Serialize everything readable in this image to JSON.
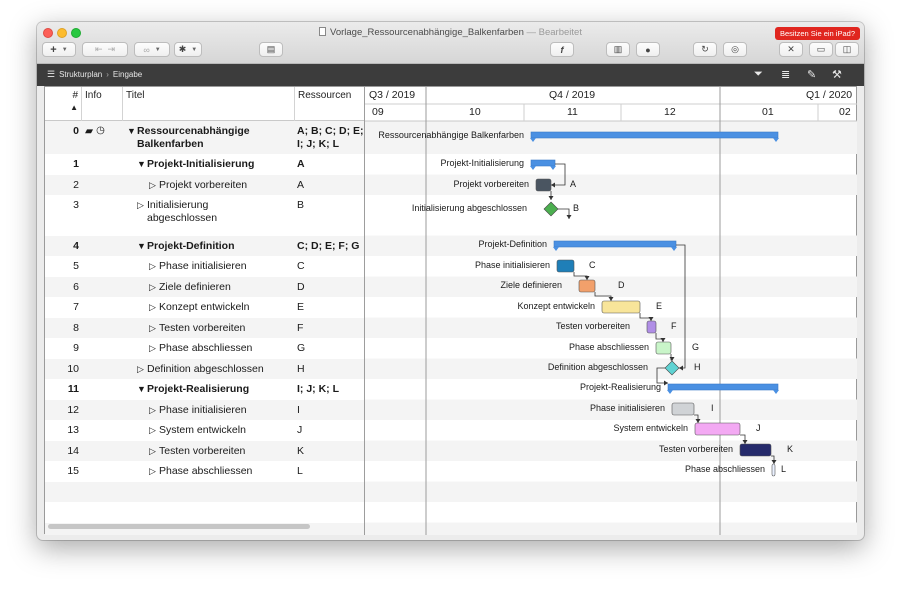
{
  "window": {
    "title": "Vorlage_Ressourcenabhängige_Balkenfarben",
    "edited_suffix": "— Bearbeitet",
    "ipad_badge": "Besitzen Sie ein iPad?"
  },
  "toolbar": {
    "add_label": "+",
    "function_label": "f"
  },
  "breadcrumb": {
    "root": "Strukturplan",
    "child": "Eingabe"
  },
  "table": {
    "headers": {
      "num": "#",
      "info": "Info",
      "title": "Titel",
      "resources": "Ressourcen"
    },
    "rows": [
      {
        "num": "0",
        "title_line1": "Ressourcenabhängige",
        "title_line2": "Balkenfarben",
        "res_line1": "A; B; C; D; E;",
        "res_line2": "I; J; K; L",
        "bold": true,
        "level": 0,
        "expanded": true
      },
      {
        "num": "1",
        "title_line1": "Projekt-Initialisierung",
        "title_line2": "",
        "res_line1": "A",
        "res_line2": "",
        "bold": true,
        "level": 1,
        "expanded": true
      },
      {
        "num": "2",
        "title_line1": "Projekt vorbereiten",
        "title_line2": "",
        "res_line1": "A",
        "res_line2": "",
        "bold": false,
        "level": 2,
        "expanded": false
      },
      {
        "num": "3",
        "title_line1": "Initialisierung",
        "title_line2": "abgeschlossen",
        "res_line1": "B",
        "res_line2": "",
        "bold": false,
        "level": 1,
        "expanded": false
      },
      {
        "num": "4",
        "title_line1": "Projekt-Definition",
        "title_line2": "",
        "res_line1": "C; D; E; F; G",
        "res_line2": "",
        "bold": true,
        "level": 1,
        "expanded": true
      },
      {
        "num": "5",
        "title_line1": "Phase initialisieren",
        "title_line2": "",
        "res_line1": "C",
        "res_line2": "",
        "bold": false,
        "level": 2,
        "expanded": false
      },
      {
        "num": "6",
        "title_line1": "Ziele definieren",
        "title_line2": "",
        "res_line1": "D",
        "res_line2": "",
        "bold": false,
        "level": 2,
        "expanded": false
      },
      {
        "num": "7",
        "title_line1": "Konzept entwickeln",
        "title_line2": "",
        "res_line1": "E",
        "res_line2": "",
        "bold": false,
        "level": 2,
        "expanded": false
      },
      {
        "num": "8",
        "title_line1": "Testen vorbereiten",
        "title_line2": "",
        "res_line1": "F",
        "res_line2": "",
        "bold": false,
        "level": 2,
        "expanded": false
      },
      {
        "num": "9",
        "title_line1": "Phase abschliessen",
        "title_line2": "",
        "res_line1": "G",
        "res_line2": "",
        "bold": false,
        "level": 2,
        "expanded": false
      },
      {
        "num": "10",
        "title_line1": "Definition abgeschlossen",
        "title_line2": "",
        "res_line1": "H",
        "res_line2": "",
        "bold": false,
        "level": 1,
        "expanded": false
      },
      {
        "num": "11",
        "title_line1": "Projekt-Realisierung",
        "title_line2": "",
        "res_line1": "I; J; K; L",
        "res_line2": "",
        "bold": true,
        "level": 1,
        "expanded": true
      },
      {
        "num": "12",
        "title_line1": "Phase initialisieren",
        "title_line2": "",
        "res_line1": "I",
        "res_line2": "",
        "bold": false,
        "level": 2,
        "expanded": false
      },
      {
        "num": "13",
        "title_line1": "System entwickeln",
        "title_line2": "",
        "res_line1": "J",
        "res_line2": "",
        "bold": false,
        "level": 2,
        "expanded": false
      },
      {
        "num": "14",
        "title_line1": "Testen vorbereiten",
        "title_line2": "",
        "res_line1": "K",
        "res_line2": "",
        "bold": false,
        "level": 2,
        "expanded": false
      },
      {
        "num": "15",
        "title_line1": "Phase abschliessen",
        "title_line2": "",
        "res_line1": "L",
        "res_line2": "",
        "bold": false,
        "level": 2,
        "expanded": false
      }
    ]
  },
  "timeline": {
    "quarters": [
      "Q3 / 2019",
      "Q4 / 2019",
      "Q1 / 2020"
    ],
    "months": [
      "09",
      "10",
      "11",
      "12",
      "01",
      "02"
    ]
  },
  "gantt": {
    "items": [
      {
        "label": "Ressourcenabhängige Balkenfarben",
        "kind": "summary",
        "resource": "",
        "color": "#4a90e2"
      },
      {
        "label": "Projekt-Initialisierung",
        "kind": "summary",
        "resource": "",
        "color": "#4a90e2"
      },
      {
        "label": "Projekt vorbereiten",
        "kind": "task",
        "resource": "A",
        "color": "#4a5561"
      },
      {
        "label": "Initialisierung abgeschlossen",
        "kind": "milestone",
        "resource": "B",
        "color": "#4caf50"
      },
      {
        "label": "Projekt-Definition",
        "kind": "summary",
        "resource": "",
        "color": "#4a90e2"
      },
      {
        "label": "Phase initialisieren",
        "kind": "task",
        "resource": "C",
        "color": "#1f7fb8"
      },
      {
        "label": "Ziele definieren",
        "kind": "task",
        "resource": "D",
        "color": "#f2a06b"
      },
      {
        "label": "Konzept entwickeln",
        "kind": "task",
        "resource": "E",
        "color": "#f8e59a"
      },
      {
        "label": "Testen vorbereiten",
        "kind": "task",
        "resource": "F",
        "color": "#b08ee6"
      },
      {
        "label": "Phase abschliessen",
        "kind": "task",
        "resource": "G",
        "color": "#c9f5c9"
      },
      {
        "label": "Definition abgeschlossen",
        "kind": "milestone",
        "resource": "H",
        "color": "#5fd3d3"
      },
      {
        "label": "Projekt-Realisierung",
        "kind": "summary",
        "resource": "",
        "color": "#4a90e2"
      },
      {
        "label": "Phase initialisieren",
        "kind": "task",
        "resource": "I",
        "color": "#d0d3d6"
      },
      {
        "label": "System entwickeln",
        "kind": "task",
        "resource": "J",
        "color": "#f3a9f3"
      },
      {
        "label": "Testen vorbereiten",
        "kind": "task",
        "resource": "K",
        "color": "#252a6b"
      },
      {
        "label": "Phase abschliessen",
        "kind": "task",
        "resource": "L",
        "color": "#eaf1ff"
      }
    ]
  }
}
